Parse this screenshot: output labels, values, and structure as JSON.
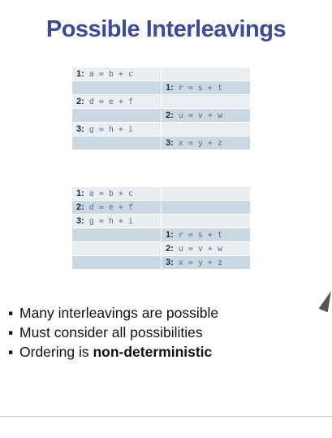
{
  "slide": {
    "title": "Possible Interleavings"
  },
  "table1": [
    {
      "left_num": "1:",
      "left_code": " a = b + c",
      "right_num": "",
      "right_code": ""
    },
    {
      "left_num": "",
      "left_code": "",
      "right_num": "1:",
      "right_code": " r = s + t"
    },
    {
      "left_num": "2:",
      "left_code": " d = e + f",
      "right_num": "",
      "right_code": ""
    },
    {
      "left_num": "",
      "left_code": "",
      "right_num": "2:",
      "right_code": " u = v + w"
    },
    {
      "left_num": "3:",
      "left_code": " g = h + i",
      "right_num": "",
      "right_code": ""
    },
    {
      "left_num": "",
      "left_code": "",
      "right_num": "3:",
      "right_code": " x = y + z"
    }
  ],
  "table2": [
    {
      "left_num": "1:",
      "left_code": " a = b + c",
      "right_num": "",
      "right_code": ""
    },
    {
      "left_num": "2:",
      "left_code": " d = e + f",
      "right_num": "",
      "right_code": ""
    },
    {
      "left_num": "3:",
      "left_code": " g = h + i",
      "right_num": "",
      "right_code": ""
    },
    {
      "left_num": "",
      "left_code": "",
      "right_num": "1:",
      "right_code": " r = s + t"
    },
    {
      "left_num": "",
      "left_code": "",
      "right_num": "2:",
      "right_code": " u = v + w"
    },
    {
      "left_num": "",
      "left_code": "",
      "right_num": "3:",
      "right_code": " x = y + z"
    }
  ],
  "bullets": {
    "marker": "▪",
    "item1": "Many interleavings are possible",
    "item2": "Must consider all possibilities",
    "item3_prefix": "Ordering is ",
    "item3_bold": "non-deterministic"
  },
  "colors": {
    "title": "#3c4b9a",
    "row_dark": "#c9d8e2",
    "row_light": "#e8eef2"
  }
}
